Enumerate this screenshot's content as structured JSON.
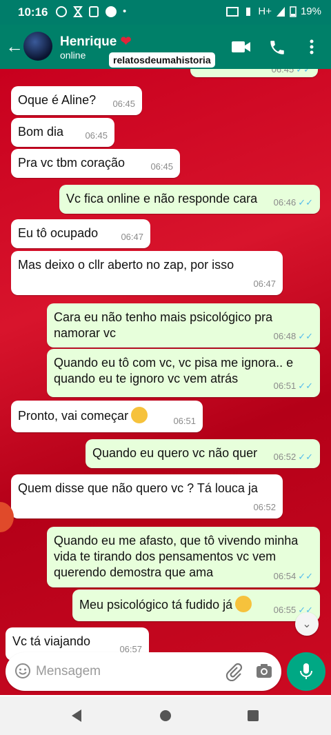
{
  "status": {
    "time": "10:16",
    "network": "H+",
    "battery": "19%"
  },
  "contact": {
    "name": "Henrique",
    "status": "online"
  },
  "watermark": "relatosdeumahistoria",
  "partial_top": {
    "time": "06:45"
  },
  "messages": [
    {
      "dir": "in",
      "text": "Oque é Aline?",
      "time": "06:45"
    },
    {
      "dir": "in",
      "text": "Bom dia",
      "time": "06:45"
    },
    {
      "dir": "in",
      "text": "Pra vc tbm coração",
      "time": "06:45"
    },
    {
      "dir": "out",
      "text": "Vc fica online e não responde cara",
      "time": "06:46"
    },
    {
      "dir": "in",
      "text": "Eu tô ocupado",
      "time": "06:47"
    },
    {
      "dir": "in",
      "text": "Mas deixo o cllr aberto no zap, por isso",
      "time": "06:47"
    },
    {
      "dir": "out",
      "text": "Cara eu não tenho mais psicológico pra\nnamorar vc",
      "time": "06:48"
    },
    {
      "dir": "out",
      "text": "Quando eu tô com vc, vc pisa me ignora.. e\nquando eu te ignoro vc vem atrás",
      "time": "06:51"
    },
    {
      "dir": "in",
      "text": "Pronto, vai começar",
      "time": "06:51",
      "emoji": "smirking-face"
    },
    {
      "dir": "out",
      "text": "Quando eu quero vc não quer",
      "time": "06:52"
    },
    {
      "dir": "in",
      "text": "Quem disse que não quero vc ? Tá louca ja",
      "time": "06:52"
    },
    {
      "dir": "out",
      "text": "Quando eu me afasto, que tô vivendo minha\nvida te tirando dos pensamentos vc vem\nquerendo demostra que ama",
      "time": "06:54"
    },
    {
      "dir": "out",
      "text": "Meu psicológico tá fudido já",
      "time": "06:55",
      "emoji": "pleading-face"
    },
    {
      "dir": "in",
      "text": "Vc tá viajando",
      "time": "06:57"
    }
  ],
  "input": {
    "placeholder": "Mensagem"
  },
  "colors": {
    "header": "#008069",
    "statusbar": "#007d6a",
    "outgoing": "#e7ffdb",
    "incoming": "#ffffff",
    "accent": "#00a884",
    "tick": "#53bdeb"
  }
}
